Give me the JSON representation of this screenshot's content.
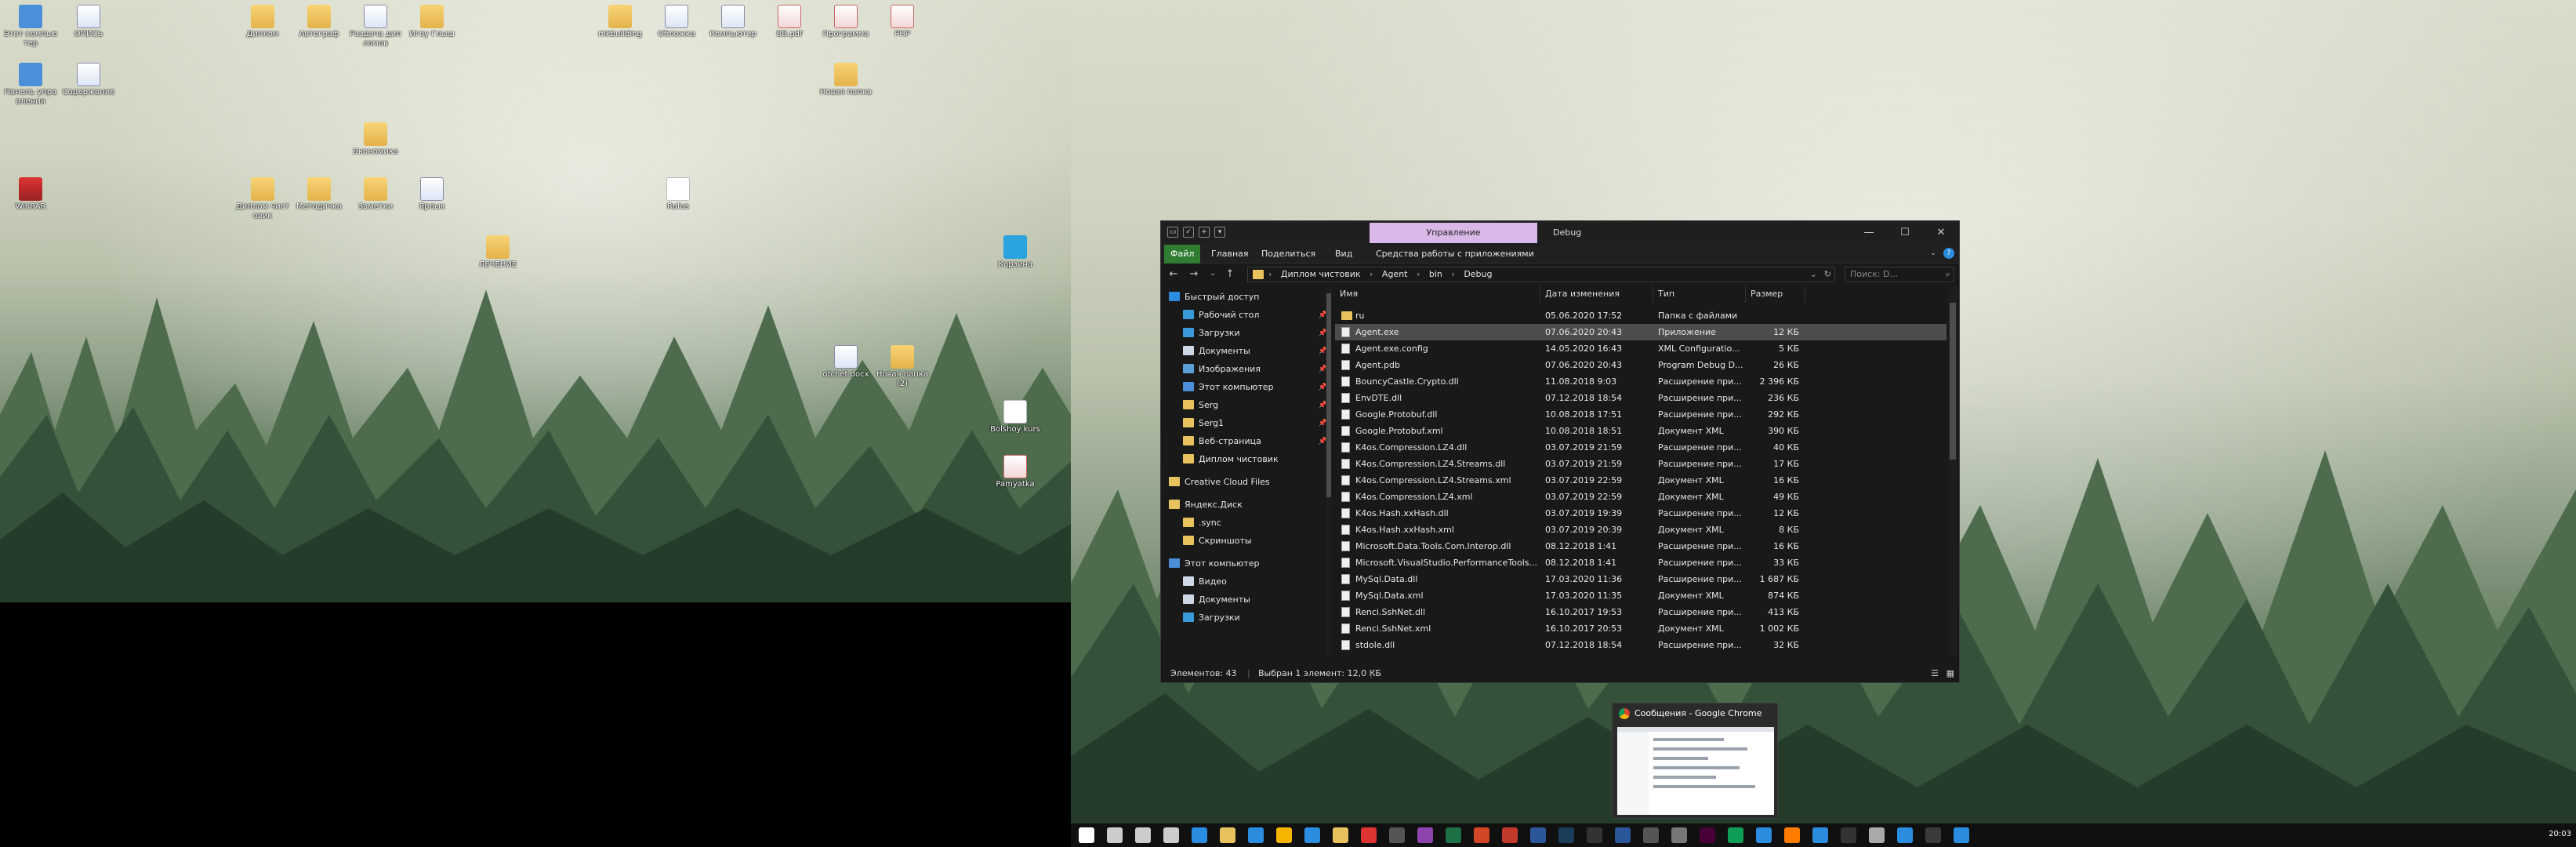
{
  "desktop_left": {
    "icons": [
      {
        "label": "Этот компьютер",
        "icon": "computer-icon",
        "kind": "gi"
      },
      {
        "label": "ОПИСЬ",
        "icon": "word-doc-icon",
        "kind": "gw"
      },
      {
        "label": "Диплом",
        "icon": "folder-icon",
        "kind": "gf"
      },
      {
        "label": "Автограф",
        "icon": "folder-icon",
        "kind": "gf"
      },
      {
        "label": "Раздача дипломов",
        "icon": "word-doc-icon",
        "kind": "gw"
      },
      {
        "label": "Игоу Глыш",
        "icon": "folder-icon",
        "kind": "gf"
      },
      {
        "label": "mkbuilding",
        "icon": "folder-icon",
        "kind": "gf"
      },
      {
        "label": "Обложка",
        "icon": "word-doc-icon",
        "kind": "gw"
      },
      {
        "label": "Компьютер",
        "icon": "word-doc-icon",
        "kind": "gw"
      },
      {
        "label": "ВВ.pdf",
        "icon": "pdf-icon",
        "kind": "gp"
      },
      {
        "label": "Программа",
        "icon": "pdf-icon",
        "kind": "gp"
      },
      {
        "label": "PHP",
        "icon": "pdf-icon",
        "kind": "gp"
      },
      {
        "label": "Панель управления",
        "icon": "control-panel-icon",
        "kind": "gi"
      },
      {
        "label": "Содержание",
        "icon": "word-doc-icon",
        "kind": "gw"
      },
      {
        "label": "Новая папка",
        "icon": "folder-icon",
        "kind": "gf"
      },
      {
        "label": "Rufus",
        "icon": "usb-icon",
        "kind": "gd"
      },
      {
        "label": "Заметки",
        "icon": "folder-icon",
        "kind": "gf"
      },
      {
        "label": "Диплом чистовик",
        "icon": "folder-icon",
        "kind": "gf"
      },
      {
        "label": "Методичка",
        "icon": "folder-icon",
        "kind": "gf"
      },
      {
        "label": "Экономика",
        "icon": "folder-icon",
        "kind": "gf"
      },
      {
        "label": "Ярлык",
        "icon": "word-doc-icon",
        "kind": "gw"
      },
      {
        "label": "WinRAR",
        "icon": "archive-icon",
        "kind": "gr"
      },
      {
        "label": "ЛЕЧЕНИЕ",
        "icon": "folder-icon",
        "kind": "gf"
      },
      {
        "label": "Корзина",
        "icon": "recycle-bin-icon",
        "kind": "gx"
      },
      {
        "label": "otchet.docx",
        "icon": "word-doc-icon",
        "kind": "gw"
      },
      {
        "label": "Новая папка (2)",
        "icon": "folder-icon",
        "kind": "gf"
      },
      {
        "label": "Bolshoy kurs",
        "icon": "document-icon",
        "kind": "gd"
      },
      {
        "label": "Pamyatka",
        "icon": "pdf-icon",
        "kind": "gp"
      }
    ]
  },
  "explorer": {
    "contextual_tab": "Управление",
    "window_title": "Debug",
    "ribbon_tabs": [
      "Файл",
      "Главная",
      "Поделиться",
      "Вид",
      "Средства работы с приложениями"
    ],
    "breadcrumb": [
      "Диплом чистовик",
      "Agent",
      "bin",
      "Debug"
    ],
    "search_placeholder": "Поиск: D...",
    "nav_items": [
      {
        "label": "Быстрый доступ",
        "indent": 0,
        "color": "#2a8de0",
        "pinned": false
      },
      {
        "label": "Рабочий стол",
        "indent": 1,
        "color": "#3a9ad9",
        "pinned": true
      },
      {
        "label": "Загрузки",
        "indent": 1,
        "color": "#3a9ad9",
        "pinned": true
      },
      {
        "label": "Документы",
        "indent": 1,
        "color": "#cfd8e6",
        "pinned": true
      },
      {
        "label": "Изображения",
        "indent": 1,
        "color": "#5aa0d6",
        "pinned": true
      },
      {
        "label": "Этот компьютер",
        "indent": 1,
        "color": "#4a8fd8",
        "pinned": true
      },
      {
        "label": "Serg",
        "indent": 1,
        "color": "#e8c25d",
        "pinned": true
      },
      {
        "label": "Serg1",
        "indent": 1,
        "color": "#e8c25d",
        "pinned": true
      },
      {
        "label": "Веб-страница",
        "indent": 1,
        "color": "#e8c25d",
        "pinned": true
      },
      {
        "label": "Диплом чистовик",
        "indent": 1,
        "color": "#e8c25d",
        "pinned": false
      },
      {
        "label": "Creative Cloud Files",
        "indent": 0,
        "color": "#e8c25d",
        "pinned": false
      },
      {
        "label": "Яндекс.Диск",
        "indent": 0,
        "color": "#e8c25d",
        "pinned": false
      },
      {
        "label": ".sync",
        "indent": 1,
        "color": "#e8c25d",
        "pinned": false
      },
      {
        "label": "Скриншоты",
        "indent": 1,
        "color": "#e8c25d",
        "pinned": false
      },
      {
        "label": "Этот компьютер",
        "indent": 0,
        "color": "#4a8fd8",
        "pinned": false
      },
      {
        "label": "Видео",
        "indent": 1,
        "color": "#cfd8e6",
        "pinned": false
      },
      {
        "label": "Документы",
        "indent": 1,
        "color": "#cfd8e6",
        "pinned": false
      },
      {
        "label": "Загрузки",
        "indent": 1,
        "color": "#3a9ad9",
        "pinned": false
      }
    ],
    "columns": [
      "Имя",
      "Дата изменения",
      "Тип",
      "Размер"
    ],
    "files": [
      {
        "name": "ru",
        "date": "05.06.2020 17:52",
        "type": "Папка с файлами",
        "size": "",
        "folder": true
      },
      {
        "name": "Agent.exe",
        "date": "07.06.2020 20:43",
        "type": "Приложение",
        "size": "12 КБ",
        "folder": false,
        "selected": true
      },
      {
        "name": "Agent.exe.config",
        "date": "14.05.2020 16:43",
        "type": "XML Configuratio...",
        "size": "5 КБ",
        "folder": false
      },
      {
        "name": "Agent.pdb",
        "date": "07.06.2020 20:43",
        "type": "Program Debug D...",
        "size": "26 КБ",
        "folder": false
      },
      {
        "name": "BouncyCastle.Crypto.dll",
        "date": "11.08.2018 9:03",
        "type": "Расширение при...",
        "size": "2 396 КБ",
        "folder": false
      },
      {
        "name": "EnvDTE.dll",
        "date": "07.12.2018 18:54",
        "type": "Расширение при...",
        "size": "236 КБ",
        "folder": false
      },
      {
        "name": "Google.Protobuf.dll",
        "date": "10.08.2018 17:51",
        "type": "Расширение при...",
        "size": "292 КБ",
        "folder": false
      },
      {
        "name": "Google.Protobuf.xml",
        "date": "10.08.2018 18:51",
        "type": "Документ XML",
        "size": "390 КБ",
        "folder": false
      },
      {
        "name": "K4os.Compression.LZ4.dll",
        "date": "03.07.2019 21:59",
        "type": "Расширение при...",
        "size": "40 КБ",
        "folder": false
      },
      {
        "name": "K4os.Compression.LZ4.Streams.dll",
        "date": "03.07.2019 21:59",
        "type": "Расширение при...",
        "size": "17 КБ",
        "folder": false
      },
      {
        "name": "K4os.Compression.LZ4.Streams.xml",
        "date": "03.07.2019 22:59",
        "type": "Документ XML",
        "size": "16 КБ",
        "folder": false
      },
      {
        "name": "K4os.Compression.LZ4.xml",
        "date": "03.07.2019 22:59",
        "type": "Документ XML",
        "size": "49 КБ",
        "folder": false
      },
      {
        "name": "K4os.Hash.xxHash.dll",
        "date": "03.07.2019 19:39",
        "type": "Расширение при...",
        "size": "12 КБ",
        "folder": false
      },
      {
        "name": "K4os.Hash.xxHash.xml",
        "date": "03.07.2019 20:39",
        "type": "Документ XML",
        "size": "8 КБ",
        "folder": false
      },
      {
        "name": "Microsoft.Data.Tools.Com.Interop.dll",
        "date": "08.12.2018 1:41",
        "type": "Расширение при...",
        "size": "16 КБ",
        "folder": false
      },
      {
        "name": "Microsoft.VisualStudio.PerformanceTools...",
        "date": "08.12.2018 1:41",
        "type": "Расширение при...",
        "size": "33 КБ",
        "folder": false
      },
      {
        "name": "MySql.Data.dll",
        "date": "17.03.2020 11:36",
        "type": "Расширение при...",
        "size": "1 687 КБ",
        "folder": false
      },
      {
        "name": "MySql.Data.xml",
        "date": "17.03.2020 11:35",
        "type": "Документ XML",
        "size": "874 КБ",
        "folder": false
      },
      {
        "name": "Renci.SshNet.dll",
        "date": "16.10.2017 19:53",
        "type": "Расширение при...",
        "size": "413 КБ",
        "folder": false
      },
      {
        "name": "Renci.SshNet.xml",
        "date": "16.10.2017 20:53",
        "type": "Документ XML",
        "size": "1 002 КБ",
        "folder": false
      },
      {
        "name": "stdole.dll",
        "date": "07.12.2018 18:54",
        "type": "Расширение при...",
        "size": "32 КБ",
        "folder": false
      }
    ],
    "status_count": "Элементов: 43",
    "status_selected": "Выбран 1 элемент: 12,0 КБ"
  },
  "preview": {
    "title": "Сообщения - Google Chrome"
  },
  "taskbar": {
    "clock": "20:03",
    "apps": [
      {
        "icon": "start-icon",
        "color": "#ffffff"
      },
      {
        "icon": "search-icon",
        "color": "#cccccc"
      },
      {
        "icon": "cortana-icon",
        "color": "#cccccc"
      },
      {
        "icon": "settings-icon",
        "color": "#cccccc"
      },
      {
        "icon": "store-icon",
        "color": "#2a8de0"
      },
      {
        "icon": "explorer-icon",
        "color": "#e8c25d"
      },
      {
        "icon": "edge-icon",
        "color": "#2a8de0"
      },
      {
        "icon": "yandex-icon",
        "color": "#f4b400"
      },
      {
        "icon": "mail-icon",
        "color": "#2a8de0"
      },
      {
        "icon": "photoshop-icon",
        "color": "#e8c25d"
      },
      {
        "icon": "file-icon",
        "color": "#d33"
      },
      {
        "icon": "app-icon",
        "color": "#555"
      },
      {
        "icon": "visual-studio-icon",
        "color": "#8e44ad"
      },
      {
        "icon": "excel-icon",
        "color": "#1e7145"
      },
      {
        "icon": "powerpoint-icon",
        "color": "#d24726"
      },
      {
        "icon": "acrobat-icon",
        "color": "#c0392b"
      },
      {
        "icon": "word-icon",
        "color": "#2b579a"
      },
      {
        "icon": "photoshop-icon",
        "color": "#1c3d5a"
      },
      {
        "icon": "terminal-icon",
        "color": "#333"
      },
      {
        "icon": "app-icon",
        "color": "#2b579a"
      },
      {
        "icon": "app-icon",
        "color": "#555"
      },
      {
        "icon": "app-icon",
        "color": "#777"
      },
      {
        "icon": "adobe-xd-icon",
        "color": "#470137"
      },
      {
        "icon": "chrome-icon",
        "color": "#0f9d58"
      },
      {
        "icon": "app-icon",
        "color": "#2a8de0"
      },
      {
        "icon": "illustrator-icon",
        "color": "#ff7c00"
      },
      {
        "icon": "app-icon",
        "color": "#2a8de0"
      },
      {
        "icon": "app-icon",
        "color": "#333"
      },
      {
        "icon": "app-icon",
        "color": "#aaa"
      },
      {
        "icon": "app-icon",
        "color": "#2a8de0"
      },
      {
        "icon": "app-icon",
        "color": "#3a3a3a"
      },
      {
        "icon": "app-icon",
        "color": "#2a8de0"
      }
    ]
  }
}
